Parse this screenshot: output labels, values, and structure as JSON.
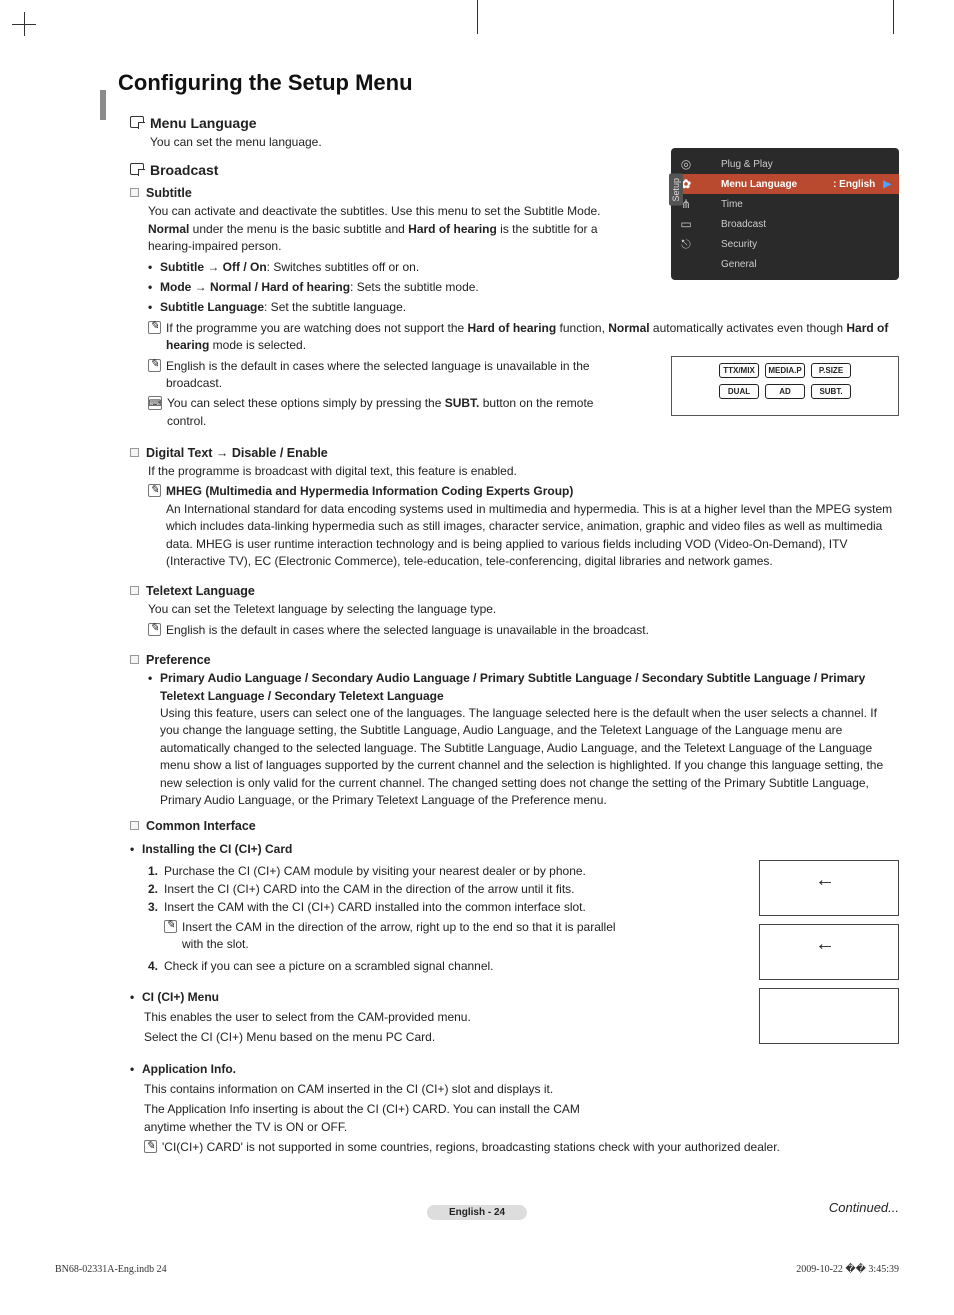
{
  "page_title": "Configuring the Setup Menu",
  "menu_language": {
    "title": "Menu Language",
    "desc": "You can set the menu language."
  },
  "broadcast": {
    "title": "Broadcast",
    "subtitle": {
      "title": "Subtitle",
      "desc": "You can activate and deactivate the subtitles. Use this menu to set the Subtitle Mode. Normal under the menu is the basic subtitle and Hard of hearing is the subtitle for a hearing-impaired person.",
      "b1_label": "Subtitle → Off / On",
      "b1_text": ": Switches subtitles off or on.",
      "b2_label": "Mode → Normal / Hard of hearing",
      "b2_text": ": Sets the subtitle mode.",
      "b3_label": "Subtitle Language",
      "b3_text": ": Set the subtitle language.",
      "n1": "If the programme you are watching does not support the Hard of hearing function, Normal automatically activates even though Hard of hearing mode is selected.",
      "n2": "English is the default in cases where the selected language is unavailable in the broadcast.",
      "n3": "You can select these options simply by pressing the SUBT. button on the remote control."
    },
    "digital_text": {
      "title": "Digital Text → Disable / Enable",
      "desc": "If the programme is broadcast with digital text, this feature is enabled.",
      "mheg_title": "MHEG (Multimedia and Hypermedia Information Coding Experts Group)",
      "mheg_body": "An International standard for data encoding systems used in multimedia and hypermedia. This is at a higher level than the MPEG system which includes data-linking hypermedia such as still images, character service, animation, graphic and video files as well as multimedia data. MHEG is user runtime interaction technology and is being applied to various fields including VOD (Video-On-Demand), ITV (Interactive TV), EC (Electronic Commerce), tele-education, tele-conferencing, digital libraries and network games."
    },
    "teletext": {
      "title": "Teletext Language",
      "desc": "You can set the Teletext language by selecting the language type.",
      "note": "English is the default in cases where the selected language is unavailable in the broadcast."
    },
    "preference": {
      "title": "Preference",
      "bullet_label": "Primary Audio Language / Secondary Audio Language / Primary Subtitle Language / Secondary Subtitle Language / Primary Teletext Language / Secondary Teletext Language",
      "body": "Using this feature, users can select one of the languages. The language selected here is the default when the user selects a channel. If you change the language setting, the Subtitle Language, Audio Language, and the Teletext Language of the Language menu are automatically changed to the selected language. The Subtitle Language, Audio Language, and the Teletext Language of the Language menu show a list of languages supported by the current channel and the selection is highlighted. If you change this language setting, the new selection is only valid for the current channel. The changed setting does not change the setting of the Primary Subtitle Language, Primary Audio Language, or the Primary Teletext Language of the Preference menu."
    },
    "ci": {
      "title": "Common Interface",
      "install_title": "Installing the CI (CI+) Card",
      "s1": "Purchase the CI (CI+) CAM module by visiting your nearest dealer or by phone.",
      "s2": "Insert the CI (CI+) CARD into the CAM in the direction of the arrow until it fits.",
      "s3": "Insert the CAM with the CI (CI+) CARD installed into the common interface slot.",
      "s3_note": "Insert the CAM in the direction of the arrow, right up to the end so that it is parallel with the slot.",
      "s4": "Check if you can see a picture on a scrambled signal channel.",
      "menu_title": "CI (CI+) Menu",
      "menu_l1": "This enables the user to select from the CAM-provided menu.",
      "menu_l2": "Select the CI (CI+) Menu based on the menu PC Card.",
      "app_title": "Application Info.",
      "app_l1": "This contains information on CAM inserted in the CI (CI+) slot and displays it.",
      "app_l2": "The Application Info inserting is about the CI (CI+) CARD. You can install the CAM anytime whether the TV is ON or OFF.",
      "app_note": "'CI(CI+) CARD' is not supported in some countries, regions, broadcasting stations check with your authorized dealer."
    }
  },
  "osd": {
    "tab": "Setup",
    "items": [
      "Plug & Play",
      "Menu Language",
      "Time",
      "Broadcast",
      "Security",
      "General"
    ],
    "sel_value": ": English"
  },
  "remote_buttons": {
    "row1": [
      "TTX/MIX",
      "MEDIA.P",
      "P.SIZE"
    ],
    "row2": [
      "DUAL",
      "AD",
      "SUBT."
    ]
  },
  "continued": "Continued...",
  "page_label": "English - 24",
  "footer_left": "BN68-02331A-Eng.indb   24",
  "footer_right": "2009-10-22   �� 3:45:39"
}
